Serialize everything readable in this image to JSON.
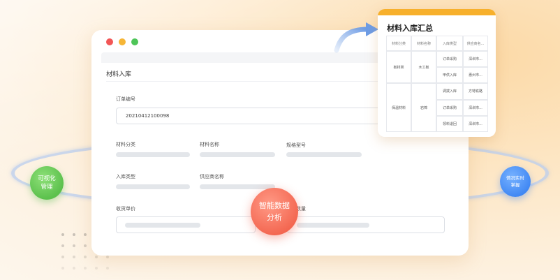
{
  "form": {
    "title": "材料入库",
    "order_label": "订单编号",
    "order_value": "20210412100098",
    "category_label": "材料分类",
    "name_label": "材料名称",
    "spec_label": "规格型号",
    "type_label": "入库类型",
    "supplier_label": "供应商名称",
    "price_label": "收货单价",
    "qty_label": "数量"
  },
  "summary": {
    "title": "材料入库汇总",
    "headers": [
      "材料分类",
      "材料名称",
      "入库类型",
      "供应商名..."
    ],
    "rows": [
      [
        "板材类",
        "木工板",
        "订单采购",
        "深圳市..."
      ],
      [
        "",
        "",
        "甲供入库",
        "惠州市..."
      ],
      [
        "保温材料",
        "岩棉",
        "调拨入库",
        "方特铁路"
      ],
      [
        "",
        "",
        "订单采购",
        "深圳市..."
      ],
      [
        "",
        "",
        "领料退回",
        "深圳市..."
      ]
    ]
  },
  "bubbles": {
    "left_line1": "可视化",
    "left_line2": "管理",
    "center_line1": "智能数据",
    "center_line2": "分析",
    "right_line1": "情况实时",
    "right_line2": "掌握"
  },
  "colors": {
    "accent": "#f7b02c",
    "green": "#5cc14d",
    "red": "#f3654f",
    "blue": "#3e86f3"
  }
}
